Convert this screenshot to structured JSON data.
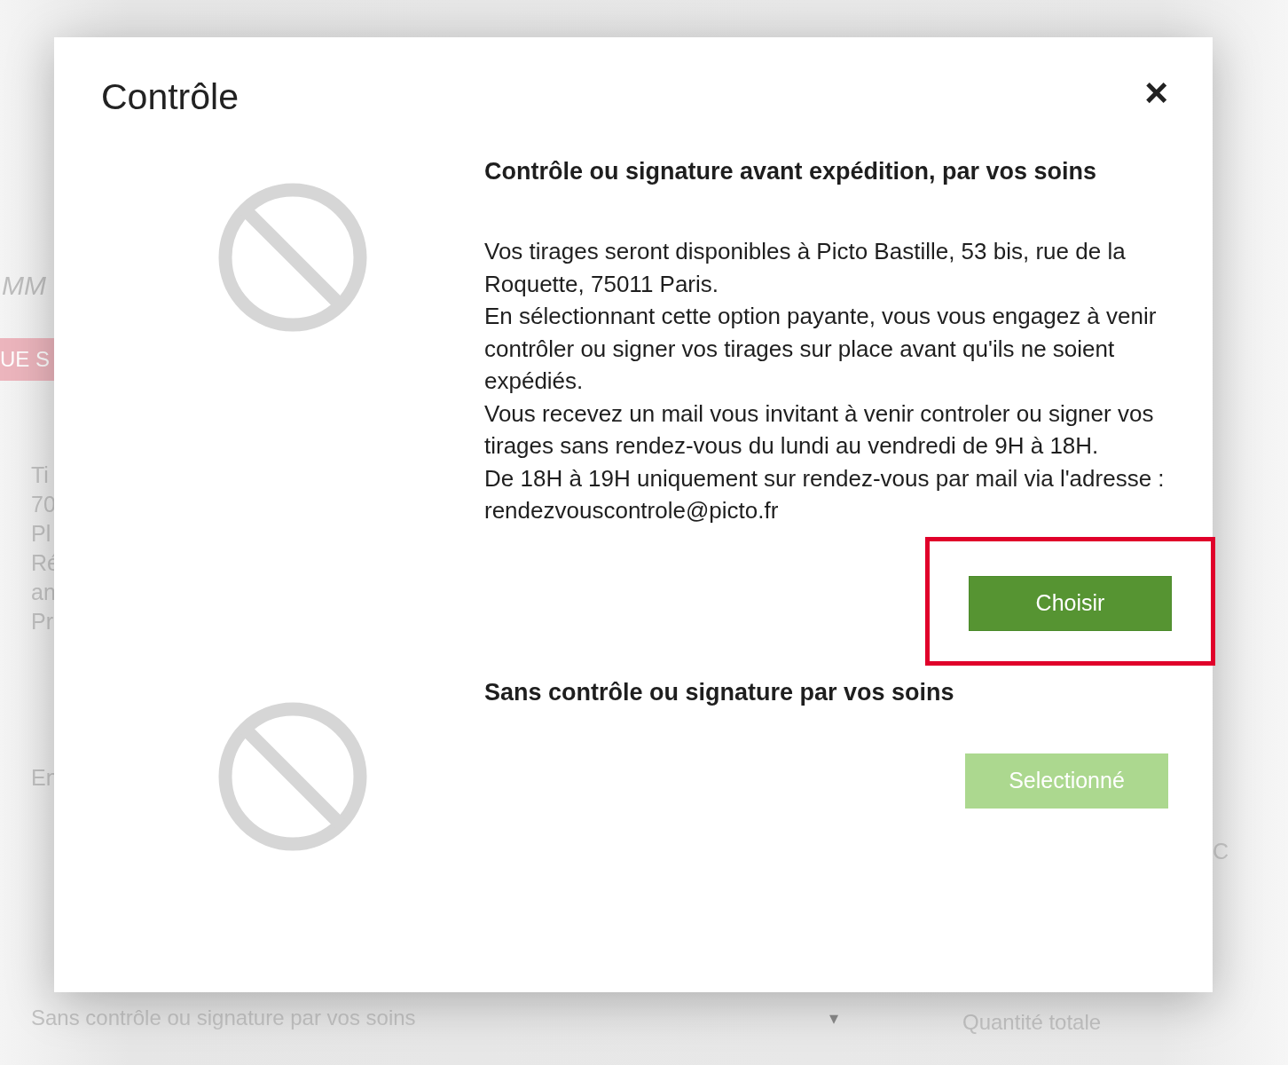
{
  "background": {
    "heading": "MM",
    "banner": "UE S",
    "details": [
      "Ti",
      "70",
      "Pl",
      "Ré",
      "an",
      "Pr"
    ],
    "shipping_label": "En",
    "right_letter": "C",
    "control_select": {
      "value": "Sans contrôle ou signature par vos soins",
      "caret": "▾"
    },
    "total_label": "Quantité totale"
  },
  "dialog": {
    "title": "Contrôle",
    "close": "×",
    "options": [
      {
        "title": "Contrôle ou signature avant expédition, par vos soins",
        "paragraphs": [
          "Vos tirages seront disponibles à Picto Bastille, 53 bis, rue de la Roquette, 75011 Paris.",
          "En sélectionnant cette option payante, vous vous engagez à venir contrôler ou signer vos tirages sur place avant qu'ils ne soient expédiés.",
          "Vous recevez un mail vous invitant à venir controler ou signer vos tirages sans rendez-vous du lundi au vendredi de 9H à 18H.",
          "De 18H à 19H uniquement sur rendez-vous par mail via l'adresse : rendezvouscontrole@picto.fr"
        ],
        "button": "Choisir",
        "selected": false,
        "highlighted": true
      },
      {
        "title": "Sans contrôle ou signature par vos soins",
        "button": "Selectionné",
        "selected": true,
        "highlighted": false
      }
    ]
  }
}
